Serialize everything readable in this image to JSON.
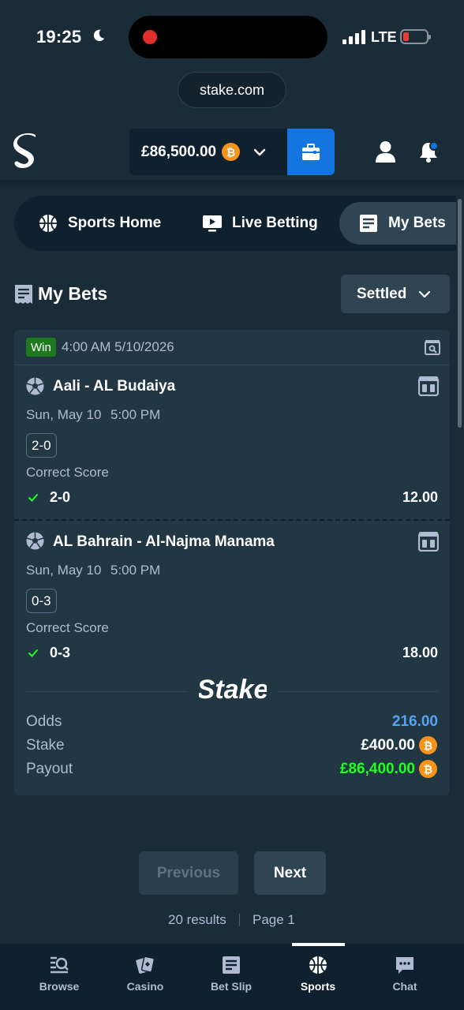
{
  "status_bar": {
    "time": "19:25",
    "network": "LTE"
  },
  "browser": {
    "url": "stake.com"
  },
  "header": {
    "balance": "£86,500.00",
    "currency_symbol": "₿"
  },
  "tabs": [
    {
      "label": "Sports Home"
    },
    {
      "label": "Live Betting"
    },
    {
      "label": "My Bets",
      "active": true
    }
  ],
  "section": {
    "title": "My Bets",
    "filter": "Settled"
  },
  "bet": {
    "status": "Win",
    "placed_at": "4:00 AM 5/10/2026",
    "legs": [
      {
        "match": "Aali - AL Budaiya",
        "date": "Sun, May 10",
        "time": "5:00 PM",
        "score": "2-0",
        "market": "Correct Score",
        "pick": "2-0",
        "odds": "12.00"
      },
      {
        "match": "AL Bahrain - Al-Najma Manama",
        "date": "Sun, May 10",
        "time": "5:00 PM",
        "score": "0-3",
        "market": "Correct Score",
        "pick": "0-3",
        "odds": "18.00"
      }
    ],
    "summary": {
      "odds_label": "Odds",
      "odds_value": "216.00",
      "stake_label": "Stake",
      "stake_value": "£400.00",
      "payout_label": "Payout",
      "payout_value": "£86,400.00"
    }
  },
  "pagination": {
    "previous": "Previous",
    "next": "Next",
    "results": "20 results",
    "page": "Page 1"
  },
  "bottom_nav": [
    {
      "label": "Browse"
    },
    {
      "label": "Casino"
    },
    {
      "label": "Bet Slip"
    },
    {
      "label": "Sports",
      "active": true
    },
    {
      "label": "Chat"
    }
  ],
  "colors": {
    "background": "#1a2c38",
    "panel": "#213743",
    "dark": "#0f212e",
    "accent_blue": "#1475e1",
    "win_green": "#1fff20",
    "odds_blue": "#55a3f5",
    "bitcoin": "#f7931a"
  }
}
